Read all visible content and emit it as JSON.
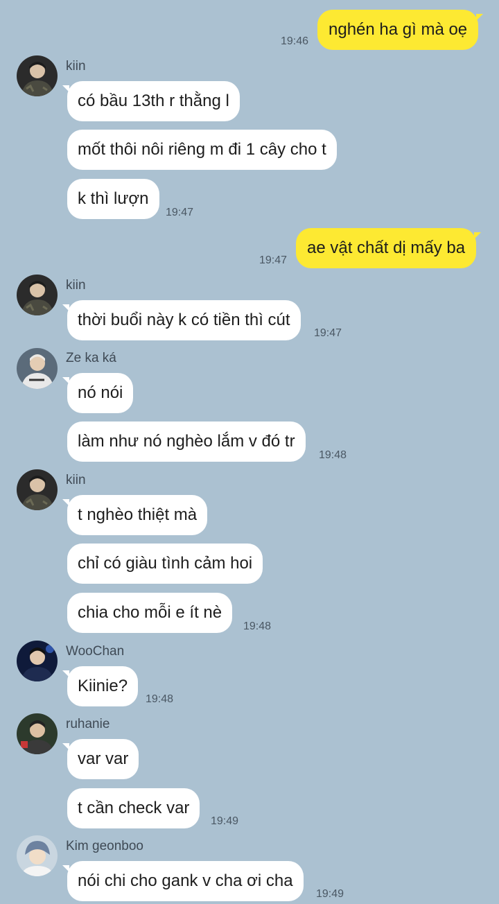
{
  "colors": {
    "background": "#abc1d1",
    "outgoing_bubble": "#fde932",
    "incoming_bubble": "#ffffff"
  },
  "messages": {
    "m1": {
      "text": "nghén ha gì mà oẹ",
      "time": "19:46"
    },
    "g1": {
      "sender": "kiin",
      "avatar_icon": "user-avatar-icon",
      "b1": "có bầu 13th r thằng l",
      "b2": "mốt thôi nôi riêng m đi 1 cây cho t",
      "b3": "k thì lượn",
      "time": "19:47"
    },
    "m2": {
      "text": "ae vật chất dị mấy ba",
      "time": "19:47"
    },
    "g2": {
      "sender": "kiin",
      "avatar_icon": "user-avatar-icon",
      "b1": "thời buổi này k có tiền thì cút",
      "time": "19:47"
    },
    "g3": {
      "sender": "Ze ka ká",
      "avatar_icon": "user-avatar-icon",
      "b1": "nó nói",
      "b2": "làm như nó nghèo lắm v đó tr",
      "time": "19:48"
    },
    "g4": {
      "sender": "kiin",
      "avatar_icon": "user-avatar-icon",
      "b1": "t nghèo thiệt mà",
      "b2": "chỉ có giàu tình cảm hoi",
      "b3": "chia cho mỗi e ít nè",
      "time": "19:48"
    },
    "g5": {
      "sender": "WooChan",
      "avatar_icon": "user-avatar-icon",
      "b1": "Kiinie?",
      "time": "19:48"
    },
    "g6": {
      "sender": "ruhanie",
      "avatar_icon": "user-avatar-icon",
      "b1": "var var",
      "b2": "t cần check var",
      "time": "19:49"
    },
    "g7": {
      "sender": "Kim geonboo",
      "avatar_icon": "user-avatar-icon",
      "b1": "nói chi cho gank v cha ơi cha",
      "time": "19:49"
    }
  }
}
